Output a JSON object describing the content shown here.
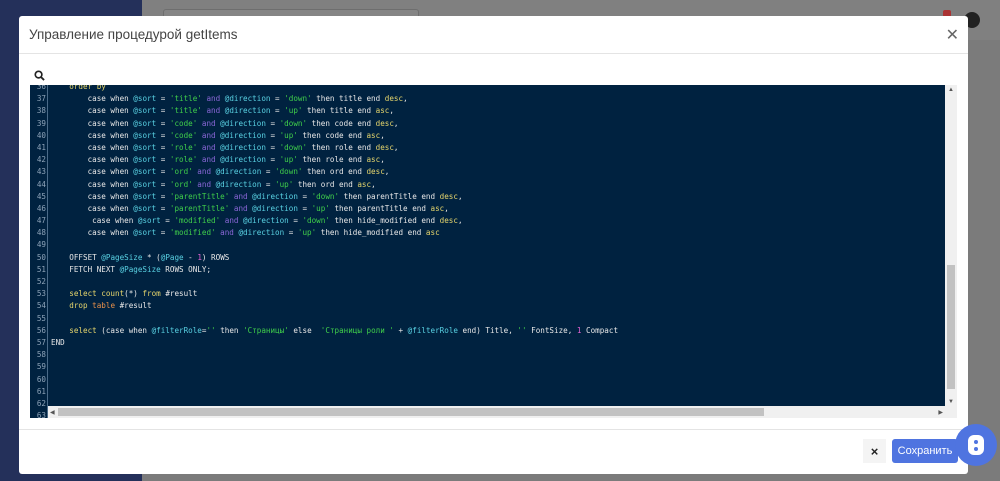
{
  "modal": {
    "title": "Управление процедурой getItems",
    "close_icon": "close-icon",
    "search_icon": "search-icon"
  },
  "footer": {
    "cancel_icon": "×",
    "save_label": "Сохранить"
  },
  "colors": {
    "editor_bg": "#002240",
    "accent": "#4f74e0"
  },
  "editor": {
    "lines": [
      {
        "n": "36",
        "t": [
          [
            "    order by",
            "kw2"
          ]
        ]
      },
      {
        "n": "37",
        "t": [
          [
            "        case when ",
            ""
          ],
          [
            "@sort",
            "var"
          ],
          [
            " = ",
            ""
          ],
          [
            "'title'",
            "str"
          ],
          [
            " and ",
            "and"
          ],
          [
            "@direction",
            "var"
          ],
          [
            " = ",
            ""
          ],
          [
            "'down'",
            "str"
          ],
          [
            " then title end ",
            ""
          ],
          [
            "desc",
            "kw2"
          ],
          [
            ",",
            ""
          ]
        ]
      },
      {
        "n": "38",
        "t": [
          [
            "        case when ",
            ""
          ],
          [
            "@sort",
            "var"
          ],
          [
            " = ",
            ""
          ],
          [
            "'title'",
            "str"
          ],
          [
            " and ",
            "and"
          ],
          [
            "@direction",
            "var"
          ],
          [
            " = ",
            ""
          ],
          [
            "'up'",
            "str"
          ],
          [
            " then title end ",
            ""
          ],
          [
            "asc",
            "kw2"
          ],
          [
            ",",
            ""
          ]
        ]
      },
      {
        "n": "39",
        "t": [
          [
            "        case when ",
            ""
          ],
          [
            "@sort",
            "var"
          ],
          [
            " = ",
            ""
          ],
          [
            "'code'",
            "str"
          ],
          [
            " and ",
            "and"
          ],
          [
            "@direction",
            "var"
          ],
          [
            " = ",
            ""
          ],
          [
            "'down'",
            "str"
          ],
          [
            " then code end ",
            ""
          ],
          [
            "desc",
            "kw2"
          ],
          [
            ",",
            ""
          ]
        ]
      },
      {
        "n": "40",
        "t": [
          [
            "        case when ",
            ""
          ],
          [
            "@sort",
            "var"
          ],
          [
            " = ",
            ""
          ],
          [
            "'code'",
            "str"
          ],
          [
            " and ",
            "and"
          ],
          [
            "@direction",
            "var"
          ],
          [
            " = ",
            ""
          ],
          [
            "'up'",
            "str"
          ],
          [
            " then code end ",
            ""
          ],
          [
            "asc",
            "kw2"
          ],
          [
            ",",
            ""
          ]
        ]
      },
      {
        "n": "41",
        "t": [
          [
            "        case when ",
            ""
          ],
          [
            "@sort",
            "var"
          ],
          [
            " = ",
            ""
          ],
          [
            "'role'",
            "str"
          ],
          [
            " and ",
            "and"
          ],
          [
            "@direction",
            "var"
          ],
          [
            " = ",
            ""
          ],
          [
            "'down'",
            "str"
          ],
          [
            " then role end ",
            ""
          ],
          [
            "desc",
            "kw2"
          ],
          [
            ",",
            ""
          ]
        ]
      },
      {
        "n": "42",
        "t": [
          [
            "        case when ",
            ""
          ],
          [
            "@sort",
            "var"
          ],
          [
            " = ",
            ""
          ],
          [
            "'role'",
            "str"
          ],
          [
            " and ",
            "and"
          ],
          [
            "@direction",
            "var"
          ],
          [
            " = ",
            ""
          ],
          [
            "'up'",
            "str"
          ],
          [
            " then role end ",
            ""
          ],
          [
            "asc",
            "kw2"
          ],
          [
            ",",
            ""
          ]
        ]
      },
      {
        "n": "43",
        "t": [
          [
            "        case when ",
            ""
          ],
          [
            "@sort",
            "var"
          ],
          [
            " = ",
            ""
          ],
          [
            "'ord'",
            "str"
          ],
          [
            " and ",
            "and"
          ],
          [
            "@direction",
            "var"
          ],
          [
            " = ",
            ""
          ],
          [
            "'down'",
            "str"
          ],
          [
            " then ord end ",
            ""
          ],
          [
            "desc",
            "kw2"
          ],
          [
            ",",
            ""
          ]
        ]
      },
      {
        "n": "44",
        "t": [
          [
            "        case when ",
            ""
          ],
          [
            "@sort",
            "var"
          ],
          [
            " = ",
            ""
          ],
          [
            "'ord'",
            "str"
          ],
          [
            " and ",
            "and"
          ],
          [
            "@direction",
            "var"
          ],
          [
            " = ",
            ""
          ],
          [
            "'up'",
            "str"
          ],
          [
            " then ord end ",
            ""
          ],
          [
            "asc",
            "kw2"
          ],
          [
            ",",
            ""
          ]
        ]
      },
      {
        "n": "45",
        "t": [
          [
            "        case when ",
            ""
          ],
          [
            "@sort",
            "var"
          ],
          [
            " = ",
            ""
          ],
          [
            "'parentTitle'",
            "str"
          ],
          [
            " and ",
            "and"
          ],
          [
            "@direction",
            "var"
          ],
          [
            " = ",
            ""
          ],
          [
            "'down'",
            "str"
          ],
          [
            " then parentTitle end ",
            ""
          ],
          [
            "desc",
            "kw2"
          ],
          [
            ",",
            ""
          ]
        ]
      },
      {
        "n": "46",
        "t": [
          [
            "        case when ",
            ""
          ],
          [
            "@sort",
            "var"
          ],
          [
            " = ",
            ""
          ],
          [
            "'parentTitle'",
            "str"
          ],
          [
            " and ",
            "and"
          ],
          [
            "@direction",
            "var"
          ],
          [
            " = ",
            ""
          ],
          [
            "'up'",
            "str"
          ],
          [
            " then parentTitle end ",
            ""
          ],
          [
            "asc",
            "kw2"
          ],
          [
            ",",
            ""
          ]
        ]
      },
      {
        "n": "47",
        "t": [
          [
            "         case when ",
            ""
          ],
          [
            "@sort",
            "var"
          ],
          [
            " = ",
            ""
          ],
          [
            "'modified'",
            "str"
          ],
          [
            " and ",
            "and"
          ],
          [
            "@direction",
            "var"
          ],
          [
            " = ",
            ""
          ],
          [
            "'down'",
            "str"
          ],
          [
            " then hide_modified end ",
            ""
          ],
          [
            "desc",
            "kw2"
          ],
          [
            ",",
            ""
          ]
        ]
      },
      {
        "n": "48",
        "t": [
          [
            "        case when ",
            ""
          ],
          [
            "@sort",
            "var"
          ],
          [
            " = ",
            ""
          ],
          [
            "'modified'",
            "str"
          ],
          [
            " and ",
            "and"
          ],
          [
            "@direction",
            "var"
          ],
          [
            " = ",
            ""
          ],
          [
            "'up'",
            "str"
          ],
          [
            " then hide_modified end ",
            ""
          ],
          [
            "asc",
            "kw2"
          ]
        ]
      },
      {
        "n": "49",
        "t": []
      },
      {
        "n": "50",
        "t": [
          [
            "    OFFSET ",
            ""
          ],
          [
            "@PageSize",
            "var"
          ],
          [
            " * (",
            ""
          ],
          [
            "@Page",
            "var"
          ],
          [
            " - ",
            ""
          ],
          [
            "1",
            "num"
          ],
          [
            ") ROWS",
            ""
          ]
        ]
      },
      {
        "n": "51",
        "t": [
          [
            "    FETCH NEXT ",
            ""
          ],
          [
            "@PageSize",
            "var"
          ],
          [
            " ROWS ONLY;",
            ""
          ]
        ]
      },
      {
        "n": "52",
        "t": []
      },
      {
        "n": "53",
        "t": [
          [
            "    select count",
            "kw2"
          ],
          [
            "(*) ",
            ""
          ],
          [
            "from",
            "kw2"
          ],
          [
            " #result",
            ""
          ]
        ]
      },
      {
        "n": "54",
        "t": [
          [
            "    drop ",
            "kw2"
          ],
          [
            "table",
            "tbl"
          ],
          [
            " #result",
            ""
          ]
        ]
      },
      {
        "n": "55",
        "t": []
      },
      {
        "n": "56",
        "t": [
          [
            "    select",
            "kw2"
          ],
          [
            " (case when ",
            ""
          ],
          [
            "@filterRole",
            "var"
          ],
          [
            "=",
            ""
          ],
          [
            "''",
            "str"
          ],
          [
            " then ",
            ""
          ],
          [
            "'Страницы'",
            "str"
          ],
          [
            " else  ",
            ""
          ],
          [
            "'Страницы роли '",
            "str"
          ],
          [
            " + ",
            ""
          ],
          [
            "@filterRole",
            "var"
          ],
          [
            " end) Title, ",
            ""
          ],
          [
            "''",
            "str"
          ],
          [
            " FontSize, ",
            ""
          ],
          [
            "1",
            "num"
          ],
          [
            " Compact",
            ""
          ]
        ]
      },
      {
        "n": "57",
        "t": [
          [
            "END",
            ""
          ]
        ]
      },
      {
        "n": "58",
        "t": []
      },
      {
        "n": "59",
        "t": []
      },
      {
        "n": "60",
        "t": []
      },
      {
        "n": "61",
        "t": []
      },
      {
        "n": "62",
        "t": []
      },
      {
        "n": "63",
        "t": []
      }
    ]
  }
}
